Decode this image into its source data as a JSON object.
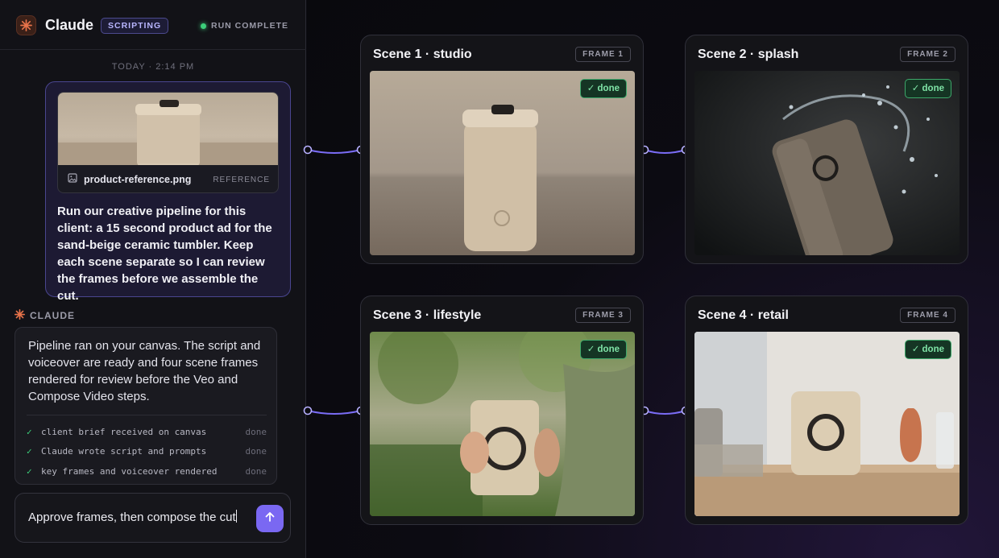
{
  "app": {
    "title": "Claude",
    "mode_badge": "SCRIPTING",
    "run_status": "RUN COMPLETE"
  },
  "chat": {
    "timestamp": "TODAY · 2:14 PM",
    "user_message": {
      "attachment": {
        "filename": "product-reference.png",
        "tag": "REFERENCE"
      },
      "text": "Run our creative pipeline for this client: a 15 second product ad for the sand-beige ceramic tumbler. Keep each scene separate so I can review the frames before we assemble the cut."
    },
    "assistant": {
      "label": "CLAUDE",
      "text": "Pipeline ran on your canvas. The script and voiceover are ready and four scene frames rendered for review before the Veo and Compose Video steps.",
      "steps": [
        {
          "label": "client brief received on canvas",
          "status": "done"
        },
        {
          "label": "Claude wrote script and prompts",
          "status": "done"
        },
        {
          "label": "key frames and voiceover rendered",
          "status": "done"
        }
      ]
    },
    "composer": {
      "value": "Approve frames, then compose the cut"
    }
  },
  "canvas": {
    "scenes": [
      {
        "title": "Scene 1 · studio",
        "frame": "FRAME 1",
        "status": "✓ done"
      },
      {
        "title": "Scene 2 · splash",
        "frame": "FRAME 2",
        "status": "✓ done"
      },
      {
        "title": "Scene 3 · lifestyle",
        "frame": "FRAME 3",
        "status": "✓ done"
      },
      {
        "title": "Scene 4 · retail",
        "frame": "FRAME 4",
        "status": "✓ done"
      }
    ]
  },
  "colors": {
    "accent": "#7a68f2",
    "success": "#3ccf7a",
    "connector": "#7a6cf5",
    "product": "#cdbfa8"
  },
  "icons": [
    "claude-logo-icon",
    "image-file-icon",
    "check-icon",
    "send-arrow-icon"
  ]
}
